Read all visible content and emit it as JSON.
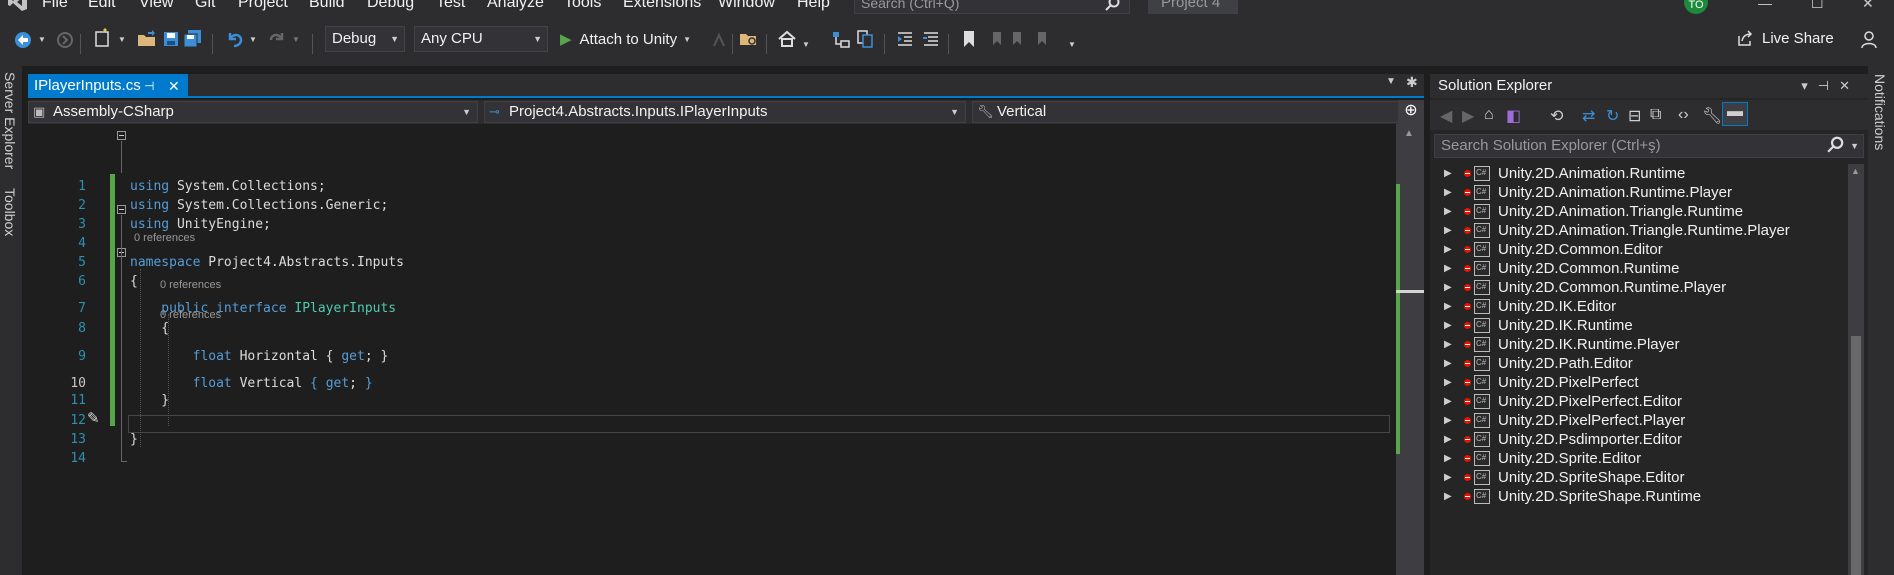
{
  "menubar": {
    "items": [
      "File",
      "Edit",
      "View",
      "Git",
      "Project",
      "Build",
      "Debug",
      "Test",
      "Analyze",
      "Tools",
      "Extensions",
      "Window",
      "Help"
    ],
    "search_placeholder": "Search (Ctrl+Q)",
    "project_name": "Project 4",
    "user_initials": "TO"
  },
  "toolbar": {
    "configuration": "Debug",
    "platform": "Any CPU",
    "attach_label": "Attach to Unity",
    "live_share": "Live Share"
  },
  "side_panels": {
    "server_explorer": "Server Explorer",
    "toolbox": "Toolbox",
    "notifications": "Notifications"
  },
  "editor": {
    "tab_label": "IPlayerInputs.cs",
    "nav": {
      "project": "Assembly-CSharp",
      "type": "Project4.Abstracts.Inputs.IPlayerInputs",
      "member": "Vertical"
    },
    "references_label": "0 references",
    "lines": [
      {
        "n": "1",
        "tokens": [
          {
            "t": "using",
            "c": "kw"
          },
          {
            "t": " System.Collections;",
            "c": ""
          }
        ]
      },
      {
        "n": "2",
        "tokens": [
          {
            "t": "using",
            "c": "kw"
          },
          {
            "t": " System.Collections.Generic;",
            "c": ""
          }
        ]
      },
      {
        "n": "3",
        "tokens": [
          {
            "t": "using",
            "c": "kw"
          },
          {
            "t": " UnityEngine;",
            "c": ""
          }
        ]
      },
      {
        "n": "4",
        "tokens": []
      },
      {
        "n": "5",
        "tokens": [
          {
            "t": "namespace",
            "c": "kw"
          },
          {
            "t": " Project4.Abstracts.Inputs",
            "c": ""
          }
        ]
      },
      {
        "n": "6",
        "tokens": [
          {
            "t": "{",
            "c": ""
          }
        ]
      },
      {
        "n": "7",
        "tokens": [
          {
            "t": "    public interface ",
            "c": "kw"
          },
          {
            "t": "IPlayerInputs",
            "c": "ty"
          }
        ]
      },
      {
        "n": "8",
        "tokens": [
          {
            "t": "    {",
            "c": ""
          }
        ]
      },
      {
        "n": "9",
        "tokens": [
          {
            "t": "        float",
            "c": "kw"
          },
          {
            "t": " Horizontal { ",
            "c": ""
          },
          {
            "t": "get",
            "c": "kw"
          },
          {
            "t": "; }",
            "c": ""
          }
        ]
      },
      {
        "n": "10",
        "tokens": [
          {
            "t": "        float",
            "c": "kw"
          },
          {
            "t": " Vertical ",
            "c": ""
          },
          {
            "t": "{",
            "c": "kw"
          },
          {
            "t": " ",
            "c": ""
          },
          {
            "t": "get",
            "c": "kw"
          },
          {
            "t": "; ",
            "c": ""
          },
          {
            "t": "}",
            "c": "kw"
          }
        ]
      },
      {
        "n": "11",
        "tokens": [
          {
            "t": "    }",
            "c": ""
          }
        ]
      },
      {
        "n": "12",
        "tokens": []
      },
      {
        "n": "13",
        "tokens": [
          {
            "t": "}",
            "c": ""
          }
        ]
      },
      {
        "n": "14",
        "tokens": []
      }
    ]
  },
  "solution_explorer": {
    "title": "Solution Explorer",
    "search_placeholder": "Search Solution Explorer (Ctrl+ş)",
    "items": [
      "Unity.2D.Animation.Runtime",
      "Unity.2D.Animation.Runtime.Player",
      "Unity.2D.Animation.Triangle.Runtime",
      "Unity.2D.Animation.Triangle.Runtime.Player",
      "Unity.2D.Common.Editor",
      "Unity.2D.Common.Runtime",
      "Unity.2D.Common.Runtime.Player",
      "Unity.2D.IK.Editor",
      "Unity.2D.IK.Runtime",
      "Unity.2D.IK.Runtime.Player",
      "Unity.2D.Path.Editor",
      "Unity.2D.PixelPerfect",
      "Unity.2D.PixelPerfect.Editor",
      "Unity.2D.PixelPerfect.Player",
      "Unity.2D.Psdimporter.Editor",
      "Unity.2D.Sprite.Editor",
      "Unity.2D.SpriteShape.Editor",
      "Unity.2D.SpriteShape.Runtime"
    ]
  },
  "colors": {
    "accent": "#007acc",
    "keyword": "#569cd6",
    "type": "#4ec9b0",
    "line_number": "#2b91af",
    "changed_margin": "#57a64a",
    "error_badge": "#e51400"
  }
}
